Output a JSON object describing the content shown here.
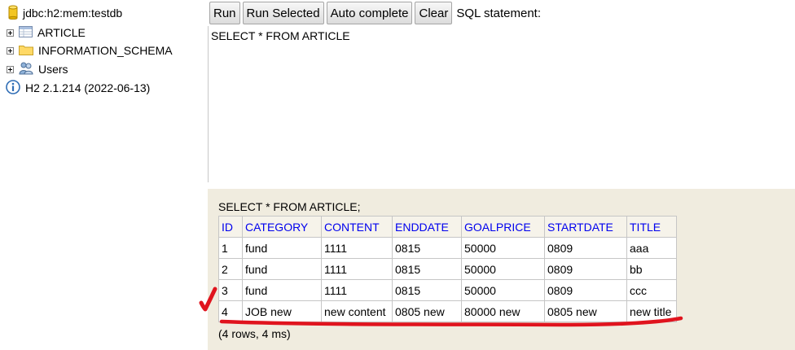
{
  "tree": {
    "connection": "jdbc:h2:mem:testdb",
    "nodes": [
      {
        "label": "ARTICLE",
        "icon": "table-icon"
      },
      {
        "label": "INFORMATION_SCHEMA",
        "icon": "folder-icon"
      },
      {
        "label": "Users",
        "icon": "users-icon"
      }
    ],
    "version": "H2 2.1.214 (2022-06-13)"
  },
  "toolbar": {
    "run": "Run",
    "run_selected": "Run Selected",
    "auto_complete": "Auto complete",
    "clear": "Clear",
    "sql_caption": "SQL statement:"
  },
  "editor": {
    "text": "SELECT * FROM ARTICLE"
  },
  "result": {
    "statement": "SELECT * FROM ARTICLE;",
    "columns": [
      "ID",
      "CATEGORY",
      "CONTENT",
      "ENDDATE",
      "GOALPRICE",
      "STARTDATE",
      "TITLE"
    ],
    "rows": [
      [
        "1",
        "fund",
        "1111",
        "0815",
        "50000",
        "0809",
        "aaa"
      ],
      [
        "2",
        "fund",
        "1111",
        "0815",
        "50000",
        "0809",
        "bb"
      ],
      [
        "3",
        "fund",
        "1111",
        "0815",
        "50000",
        "0809",
        "ccc"
      ],
      [
        "4",
        "JOB new",
        "new content",
        "0805 new",
        "80000 new",
        "0805 new",
        "new title"
      ]
    ],
    "footer": "(4 rows, 4 ms)"
  },
  "colors": {
    "result_bg": "#f0ecdf",
    "header_text": "#0000ee",
    "annotation": "#e0141e"
  }
}
